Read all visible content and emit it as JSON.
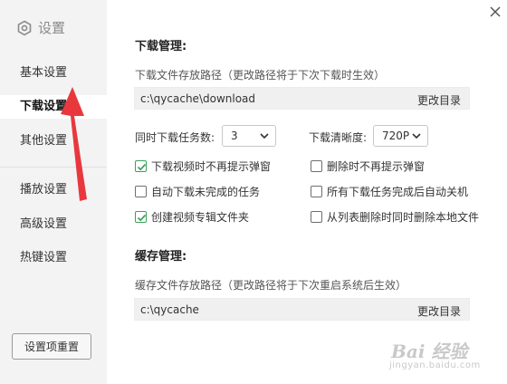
{
  "sidebar": {
    "title": "设置",
    "items": [
      {
        "label": "基本设置"
      },
      {
        "label": "下载设置"
      },
      {
        "label": "其他设置"
      },
      {
        "label": "播放设置"
      },
      {
        "label": "高级设置"
      },
      {
        "label": "热键设置"
      }
    ],
    "reset_label": "设置项重置"
  },
  "download": {
    "section_title": "下载管理:",
    "path_desc": "下载文件存放路径（更改路径将于下次下载时生效）",
    "path_value": "c:\\qycache\\download",
    "change_dir_label": "更改目录",
    "tasks_label": "同时下载任务数:",
    "tasks_value": "3",
    "quality_label": "下载清晰度:",
    "quality_value": "720P",
    "options": [
      {
        "label": "下载视频时不再提示弹窗",
        "checked": true
      },
      {
        "label": "删除时不再提示弹窗",
        "checked": false
      },
      {
        "label": "自动下载未完成的任务",
        "checked": false
      },
      {
        "label": "所有下载任务完成后自动关机",
        "checked": false
      },
      {
        "label": "创建视频专辑文件夹",
        "checked": true
      },
      {
        "label": "从列表删除时同时删除本地文件",
        "checked": false
      }
    ]
  },
  "cache": {
    "section_title": "缓存管理:",
    "path_desc": "缓存文件存放路径（更改路径将于下次重启系统后生效）",
    "path_value": "c:\\qycache",
    "change_dir_label": "更改目录"
  },
  "watermark": {
    "line1": "Bai 经验",
    "line2": "jingyan.baidu.com"
  },
  "colors": {
    "accent_check": "#3aa05c",
    "annotation_arrow": "#e8383d",
    "sidebar_bg": "#f3f3f3"
  },
  "icons": {
    "settings": "settings-hex-icon",
    "close": "close-icon",
    "dropdown": "chevron-down-icon",
    "check": "check-icon"
  }
}
